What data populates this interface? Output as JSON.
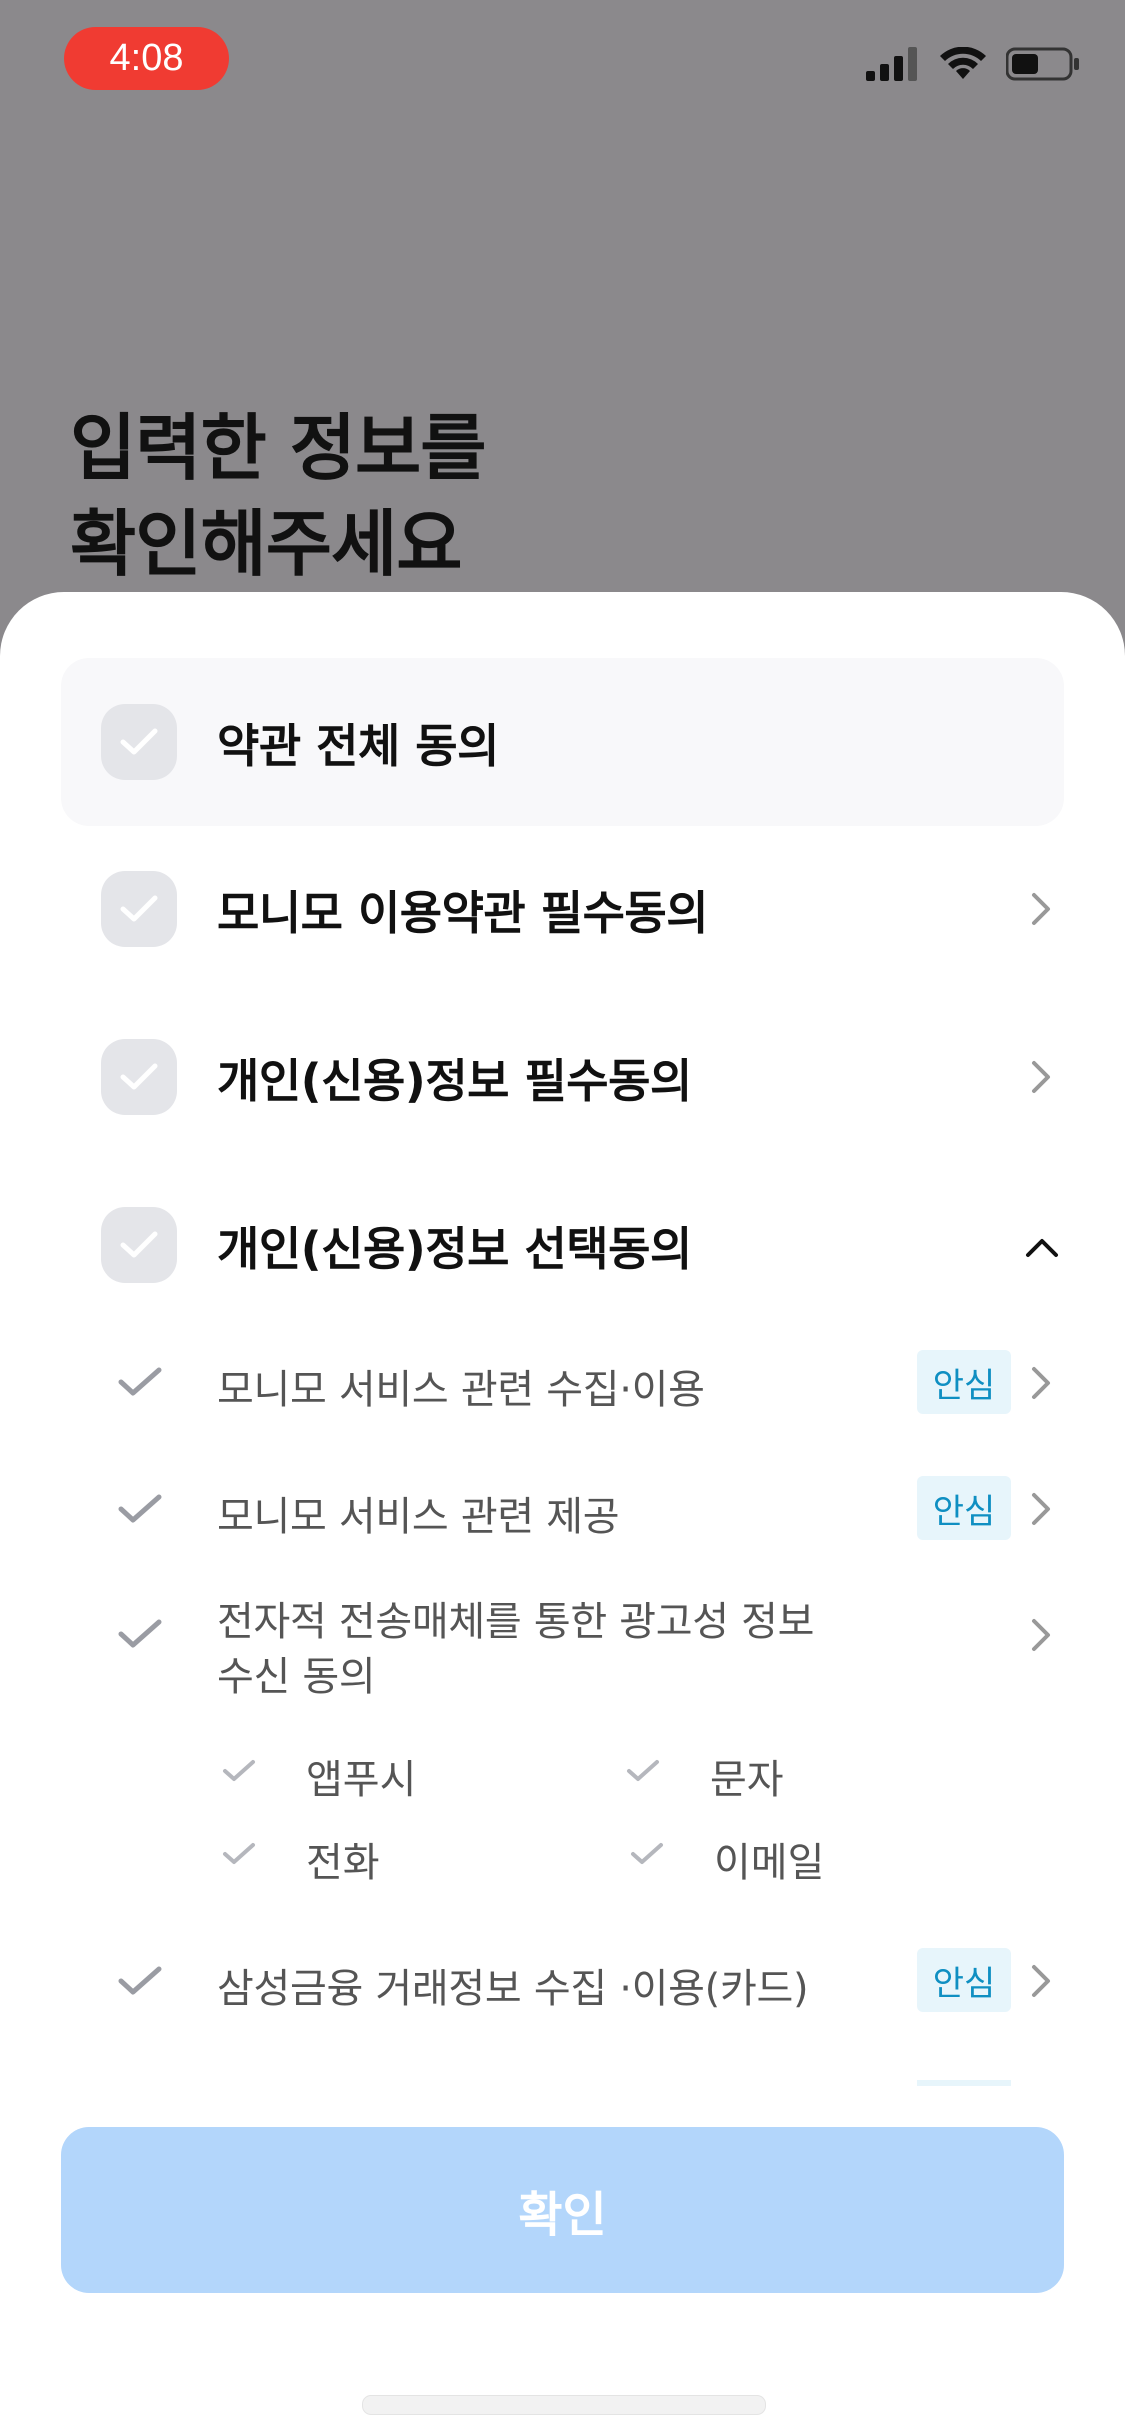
{
  "status_bar": {
    "time": "4:08"
  },
  "page": {
    "title_line1": "입력한 정보를",
    "title_line2": "확인해주세요"
  },
  "agreements": {
    "all": {
      "label": "약관 전체 동의"
    },
    "required_terms": {
      "label": "모니모 이용약관 필수동의"
    },
    "required_personal": {
      "label": "개인(신용)정보 필수동의"
    },
    "optional_personal": {
      "label": "개인(신용)정보 선택동의",
      "items": [
        {
          "label": "모니모 서비스 관련 수집·이용",
          "badge": "안심"
        },
        {
          "label": "모니모 서비스 관련 제공",
          "badge": "안심"
        },
        {
          "label_line1": "전자적 전송매체를 통한 광고성 정보",
          "label_line2": "수신 동의"
        },
        {
          "label": "삼성금융 거래정보 수집 ·이용(카드)",
          "badge": "안심"
        }
      ],
      "channels": [
        "앱푸시",
        "문자",
        "전화",
        "이메일"
      ]
    }
  },
  "confirm_button": {
    "label": "확인"
  },
  "colors": {
    "dim_overlay": "#8b898c",
    "badge_text": "#0f8fc2",
    "badge_bg": "#e7f5fb",
    "confirm_disabled": "#b3d6fb",
    "status_time_bg": "#f03b32"
  }
}
